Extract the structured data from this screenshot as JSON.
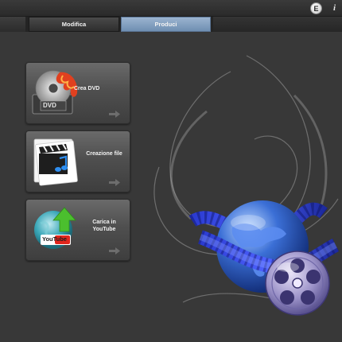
{
  "topbar": {
    "e_button_label": "E",
    "info_button_label": "i"
  },
  "tabs": [
    {
      "label": "Modifica",
      "active": false
    },
    {
      "label": "Produci",
      "active": true
    }
  ],
  "cards": [
    {
      "label": "Crea DVD",
      "icon": "dvd-disc-icon",
      "badge": "DVD"
    },
    {
      "label": "Creazione file",
      "icon": "clapper-file-icon"
    },
    {
      "label": "Carica in YouTube",
      "icon": "youtube-globe-icon",
      "badge": "YouTube"
    }
  ],
  "colors": {
    "accent_tab": "#7f9cc0",
    "background": "#383838",
    "card": "#555555",
    "globe": "#3b6fd6"
  }
}
